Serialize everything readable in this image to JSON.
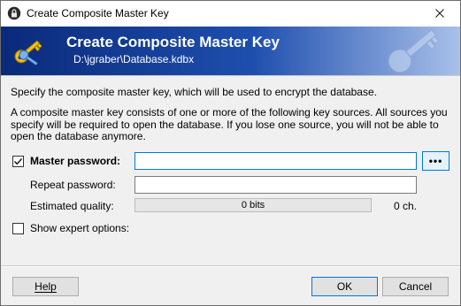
{
  "window": {
    "title": "Create Composite Master Key"
  },
  "banner": {
    "title": "Create Composite Master Key",
    "subtitle": "D:\\jgraber\\Database.kdbx"
  },
  "intro": "Specify the composite master key, which will be used to encrypt the database.",
  "description": "A composite master key consists of one or more of the following key sources. All sources you specify will be required to open the database. If you lose one source, you will not be able to open the database anymore.",
  "master_password": {
    "checked": true,
    "label": "Master password:",
    "value": "",
    "toggle_label": "•••"
  },
  "repeat_password": {
    "label": "Repeat password:",
    "value": ""
  },
  "quality": {
    "label": "Estimated quality:",
    "bar_text": "0 bits",
    "chars": "0 ch.",
    "level": 0
  },
  "expert": {
    "checked": false,
    "label": "Show expert options:"
  },
  "buttons": {
    "help": "Help",
    "ok": "OK",
    "cancel": "Cancel"
  },
  "colors": {
    "banner_start": "#0a2a7a",
    "banner_end": "#a9c1ea",
    "focus_border": "#0078d7"
  },
  "icons": {
    "title": "lock-icon",
    "banner": "keys-icon",
    "close": "close-icon",
    "check": "checkmark-icon"
  }
}
